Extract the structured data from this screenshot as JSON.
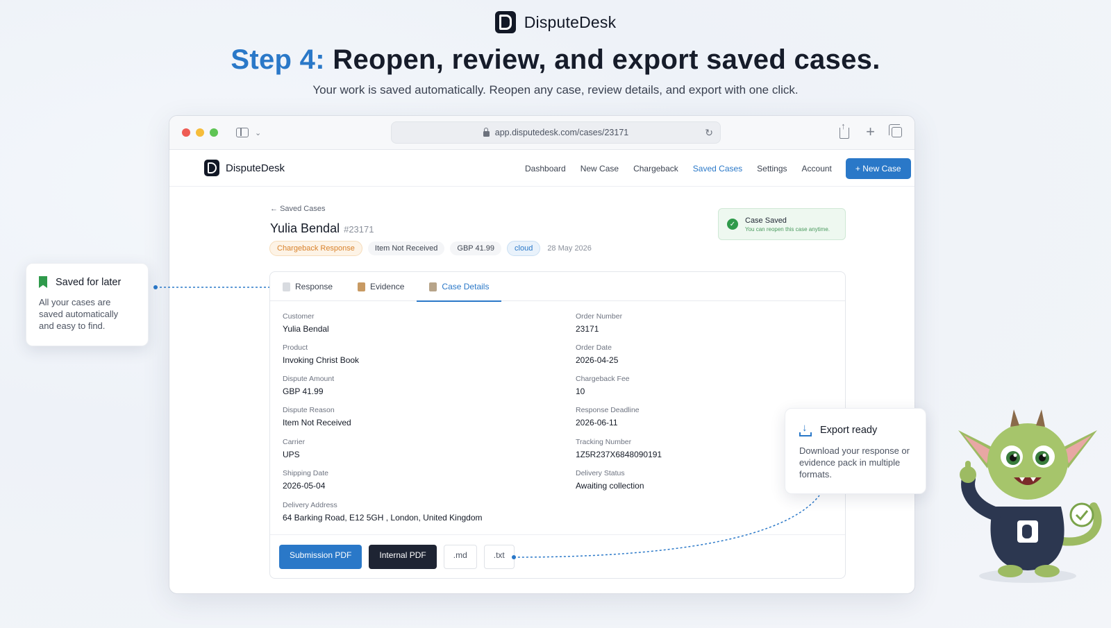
{
  "header": {
    "brand": "DisputeDesk",
    "step_label": "Step 4:",
    "headline": "Reopen, review, and export saved cases.",
    "subline": "Your work is saved automatically. Reopen any case, review details, and export with one click."
  },
  "browser": {
    "url": "app.disputedesk.com/cases/23171"
  },
  "app": {
    "brand": "DisputeDesk",
    "nav": [
      "Dashboard",
      "New Case",
      "Chargeback",
      "Saved Cases",
      "Settings",
      "Account"
    ],
    "active_nav": "Saved Cases",
    "new_case_label": "+ New Case",
    "colors": {
      "accent": "#2a78c8",
      "success": "#2f9a4b",
      "dark": "#1e2433"
    }
  },
  "case": {
    "back_label": "Saved Cases",
    "name": "Yulia Bendal",
    "number": "#23171",
    "badges": {
      "type": "Chargeback Response",
      "reason": "Item Not Received",
      "amount": "GBP 41.99",
      "storage": "cloud",
      "date": "28 May 2026"
    },
    "toast": {
      "title": "Case Saved",
      "subtitle": "You can reopen this case anytime."
    },
    "tabs": [
      "Response",
      "Evidence",
      "Case Details"
    ],
    "active_tab": "Case Details",
    "fields": {
      "customer": {
        "label": "Customer",
        "value": "Yulia Bendal"
      },
      "order_number": {
        "label": "Order Number",
        "value": "23171"
      },
      "product": {
        "label": "Product",
        "value": "Invoking Christ Book"
      },
      "order_date": {
        "label": "Order Date",
        "value": "2026-04-25"
      },
      "dispute_amount": {
        "label": "Dispute Amount",
        "value": "GBP 41.99"
      },
      "chargeback_fee": {
        "label": "Chargeback Fee",
        "value": "10"
      },
      "dispute_reason": {
        "label": "Dispute Reason",
        "value": "Item Not Received"
      },
      "response_deadline": {
        "label": "Response Deadline",
        "value": "2026-06-11"
      },
      "carrier": {
        "label": "Carrier",
        "value": "UPS"
      },
      "tracking_number": {
        "label": "Tracking Number",
        "value": "1Z5R237X6848090191"
      },
      "shipping_date": {
        "label": "Shipping Date",
        "value": "2026-05-04"
      },
      "delivery_status": {
        "label": "Delivery Status",
        "value": "Awaiting collection"
      },
      "delivery_address": {
        "label": "Delivery Address",
        "value": "64 Barking Road, E12 5GH , London, United Kingdom"
      }
    },
    "export_buttons": {
      "submission_pdf": "Submission PDF",
      "internal_pdf": "Internal PDF",
      "md": ".md",
      "txt": ".txt"
    }
  },
  "callouts": {
    "saved": {
      "title": "Saved for later",
      "body": "All your cases are saved automatically and easy to find."
    },
    "export": {
      "title": "Export ready",
      "body": "Download your response or evidence pack in multiple formats."
    }
  },
  "icons": [
    "bookmark-icon",
    "download-icon",
    "check-icon",
    "lock-icon",
    "reload-icon",
    "share-icon",
    "plus-icon",
    "tabs-icon",
    "sidebar-icon",
    "chevron-down-icon",
    "arrow-left-icon",
    "document-icon",
    "clipboard-icon",
    "notepad-icon"
  ]
}
